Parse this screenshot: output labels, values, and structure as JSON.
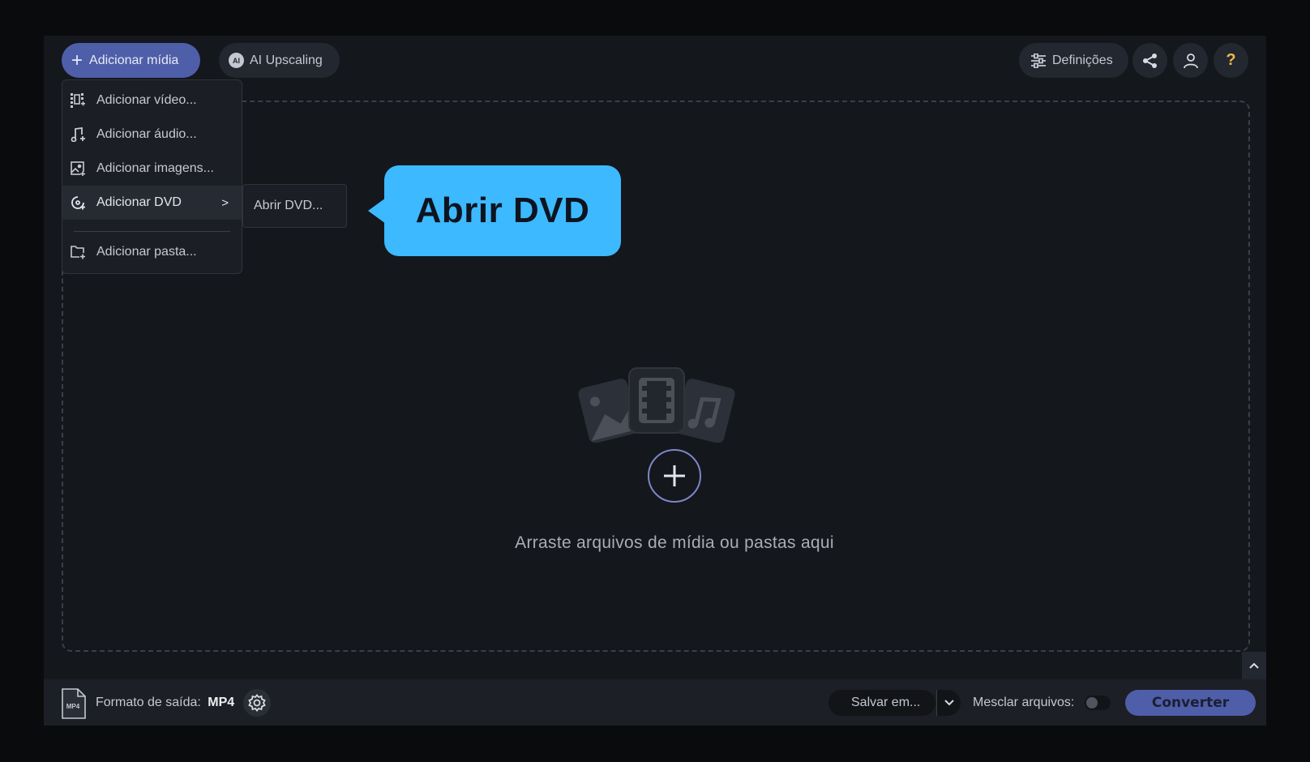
{
  "toolbar": {
    "add_media_label": "Adicionar mídia",
    "ai_upscaling_label": "AI Upscaling",
    "ai_badge": "AI",
    "settings_label": "Definições",
    "help_label": "?"
  },
  "add_menu": {
    "items": [
      {
        "label": "Adicionar vídeo...",
        "icon": "video-add-icon"
      },
      {
        "label": "Adicionar áudio...",
        "icon": "audio-add-icon"
      },
      {
        "label": "Adicionar imagens...",
        "icon": "image-add-icon"
      },
      {
        "label": "Adicionar DVD",
        "icon": "dvd-icon",
        "active": true,
        "has_submenu": true
      },
      {
        "label": "Adicionar pasta...",
        "icon": "folder-add-icon"
      }
    ],
    "submenu_chevron": ">",
    "submenu": {
      "items": [
        {
          "label": "Abrir DVD..."
        }
      ]
    }
  },
  "callout": {
    "text": "Abrir DVD"
  },
  "dropzone": {
    "text": "Arraste arquivos de mídia ou pastas aqui"
  },
  "bottom_bar": {
    "format_label": "Formato de saída:",
    "format_value": "MP4",
    "format_icon_text": "MP4",
    "save_label": "Salvar em...",
    "merge_label": "Mesclar arquivos:",
    "merge_enabled": false,
    "convert_label": "Converter"
  },
  "colors": {
    "accent": "#4f5ea8",
    "callout": "#3db9ff",
    "help": "#f2b84a",
    "background": "#14171c"
  }
}
